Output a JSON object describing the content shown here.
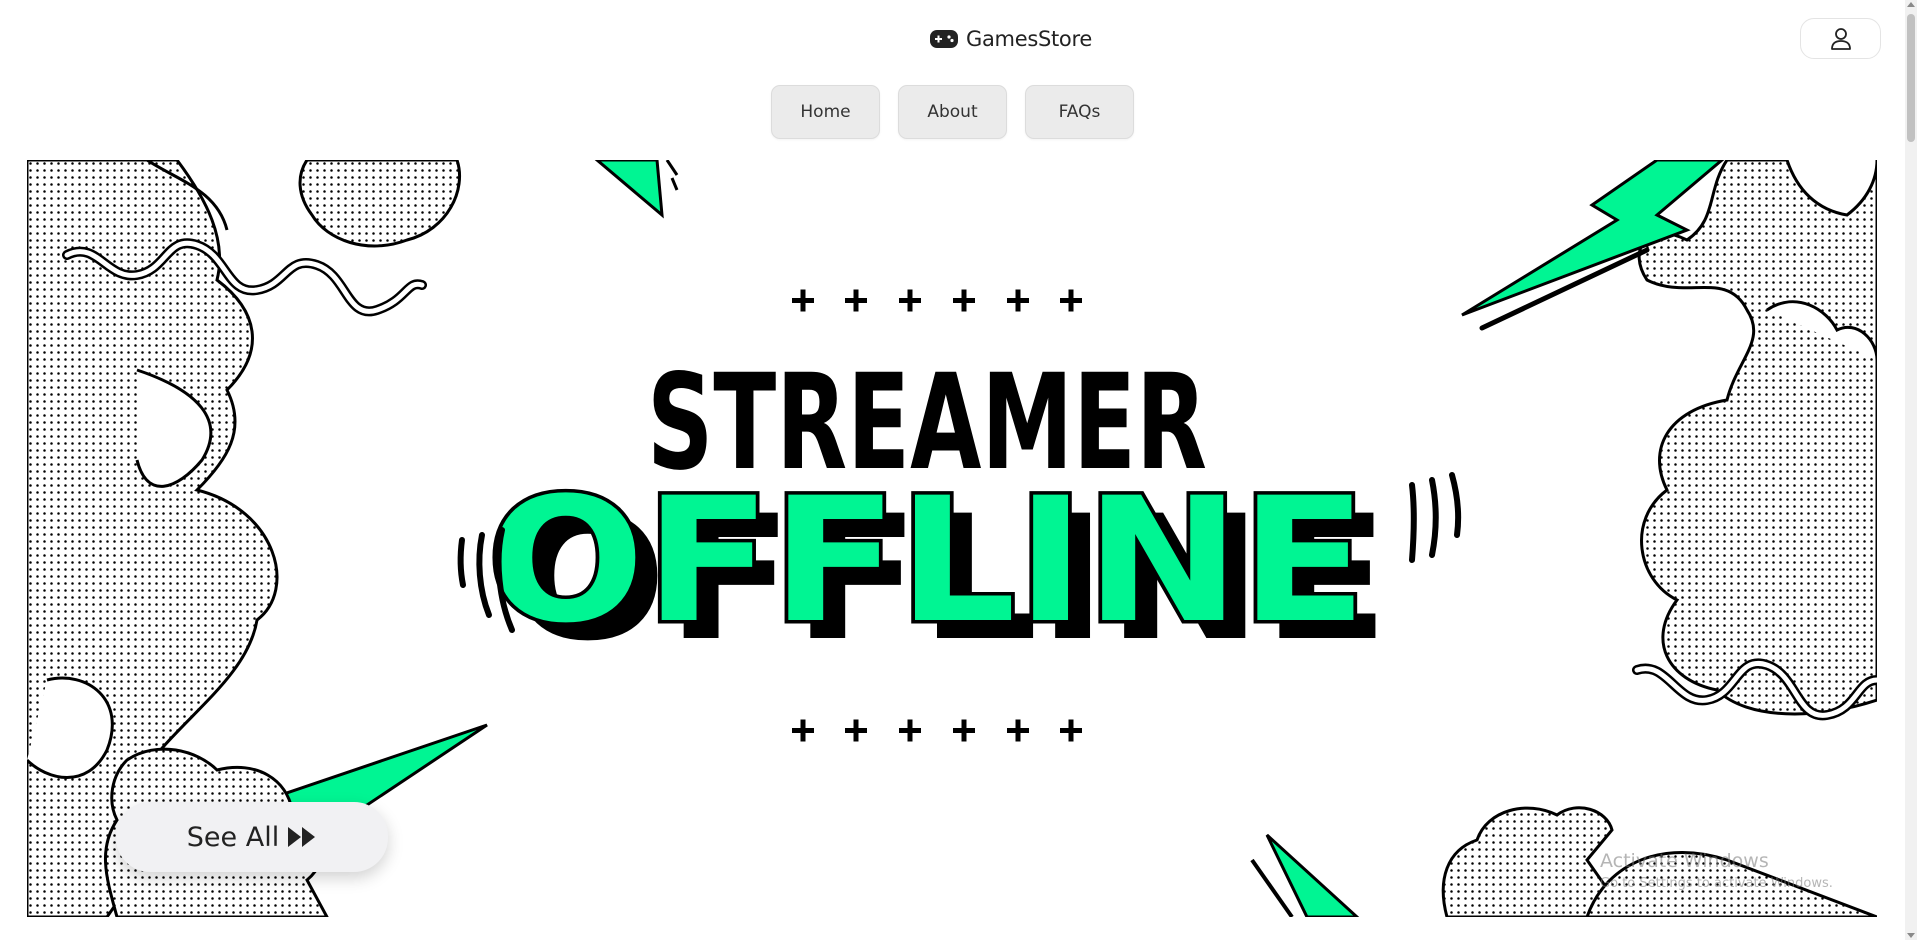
{
  "header": {
    "brand_name": "GamesStore",
    "brand_icon": "gamepad-icon",
    "account_icon": "user-icon"
  },
  "nav": {
    "items": [
      {
        "label": "Home"
      },
      {
        "label": "About"
      },
      {
        "label": "FAQs"
      }
    ]
  },
  "banner": {
    "headline_top": "STREAMER",
    "headline_bottom": "OFFLINE",
    "accent_color": "#00f593",
    "ink_color": "#000000"
  },
  "actions": {
    "see_all_label": "See All",
    "see_all_icon": "fast-forward-icon"
  },
  "watermark": {
    "title": "Activate Windows",
    "subtitle": "Go to Settings to activate Windows."
  }
}
